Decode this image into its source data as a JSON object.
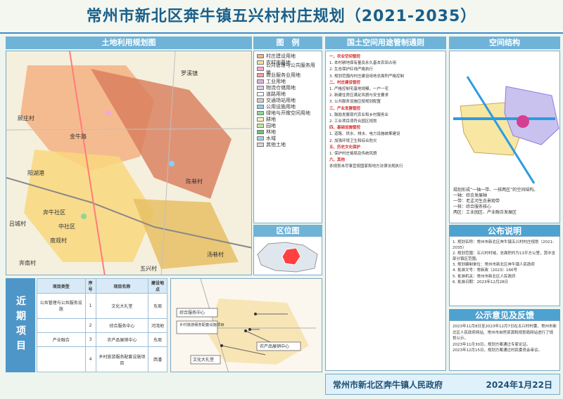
{
  "title": "常州市新北区奔牛镇五兴村村庄规划（2021-2035）",
  "panels": {
    "land_use": "土地利用规划图",
    "legend": "图　例",
    "control": "国土空间用途管制通则",
    "structure": "空间结构",
    "region": "区位图",
    "announcement": "公布说明",
    "feedback": "公示意见及反馈"
  },
  "map_labels": [
    "罗溪镇",
    "顾庄村",
    "奔牛社区",
    "陈巷村",
    "吕城村",
    "中社区",
    "五兴村",
    "奔南村",
    "南观村",
    "阳湖港",
    "金牛路",
    "汤巷村"
  ],
  "legend_items": [
    {
      "label": "村庄建设用地",
      "color": "#f4b183"
    },
    {
      "label": "农村宅基地",
      "color": "#ffe08a"
    },
    {
      "label": "公共管理与公共服务用地",
      "color": "#f7a8d3"
    },
    {
      "label": "商业服务业用地",
      "color": "#f2a0a0"
    },
    {
      "label": "工业用地",
      "color": "#d7b5d8"
    },
    {
      "label": "物流仓储用地",
      "color": "#d9ccec"
    },
    {
      "label": "道路用地",
      "color": "#ffffff"
    },
    {
      "label": "交通场站用地",
      "color": "#cfcfcf"
    },
    {
      "label": "公用设施用地",
      "color": "#87cefa"
    },
    {
      "label": "绿地与开敞空间用地",
      "color": "#8fd694"
    },
    {
      "label": "耕地",
      "color": "#f6f1c7"
    },
    {
      "label": "园地",
      "color": "#c8e6a0"
    },
    {
      "label": "林地",
      "color": "#6fbf73"
    },
    {
      "label": "水域",
      "color": "#9fd3f0"
    },
    {
      "label": "其他土地",
      "color": "#d8d8d8"
    }
  ],
  "control_text": [
    "一、农业空间管控",
    "1. 本村耕地保有量及永久基本农田占用",
    "2. 生态保护红线严格执行",
    "3. 规划范围内村庄建设用地总面积严格控制",
    "二、村庄建设管控",
    "1. 严格控制宅基地规模，一户一宅",
    "2. 新建住房应满足风貌与安全要求",
    "3. 公共服务设施应按规划配置",
    "三、产业发展管控",
    "1. 鼓励发展现代农业和乡村服务业",
    "2. 工业项目须符合园区规划",
    "四、基础设施管控",
    "1. 道路、供水、排水、电力设施统筹建设",
    "2. 加强环境卫生和综合防灾",
    "五、历史文化保护",
    "1. 保护村庄格局及传统风貌",
    "六、其他",
    "本规划未尽事宜按国家和地方法律法规执行"
  ],
  "structure_text": [
    "规划形成“一轴一带、一核两区”的空间结构。",
    "一轴：综合发展轴",
    "一带：老孟河生态景观带",
    "一核：综合服务核心",
    "两区：工业园区、产业融合发展区"
  ],
  "announcement_text": [
    "1. 规划名称：常州市新北区奔牛镇五兴村村庄规划（2021-2035）",
    "2. 规划范围：五兴村村域，总面积约为13平方公里，其中含部分镇区范围。",
    "3. 规划编制单位：常州市新北区奔牛镇人民政府",
    "4. 批准文号：常新政〔2023〕166号",
    "5. 批准机关：常州市新北区人民政府",
    "6. 批准日期：2023年12月28日"
  ],
  "feedback_text": [
    "2023年11月8日至2023年12月7日在五兴村村委、常州市新北区人民政府网站、常州市自然资源和规划局网站进行了规划公示。",
    "2023年11月30日，规划方案通过专家论证。",
    "2023年12月15日，规划方案通过村民委员会审议。"
  ],
  "near_projects": {
    "label": "近期项目",
    "headers": [
      "项目类型",
      "序号",
      "项目名称",
      "建设地点"
    ],
    "rows": [
      [
        "公共管理与公共服务设施",
        "1",
        "文化大礼堂",
        "东周"
      ],
      [
        "",
        "2",
        "综合服务中心",
        "河湾地"
      ],
      [
        "产业融合",
        "3",
        "农产品展销中心",
        "东周"
      ],
      [
        "",
        "4",
        "乡村旅游服务配套设施项目",
        "西潘"
      ]
    ]
  },
  "project_map_labels": [
    "综合服务中心",
    "乡村旅游服务配套设施项目",
    "农产品展销中心",
    "文化大礼堂"
  ],
  "footer": {
    "left": "常州市新北区奔牛镇人民政府",
    "right": "2024年1月22日"
  }
}
